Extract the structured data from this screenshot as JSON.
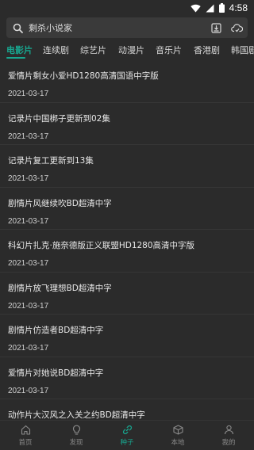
{
  "status": {
    "time": "4:58",
    "icons": [
      "wifi-icon",
      "signal-icon",
      "battery-icon"
    ]
  },
  "search": {
    "text": "剩杀小说家",
    "icons": [
      "search-icon",
      "download-icon",
      "refresh-cloud-icon"
    ]
  },
  "tabs": [
    {
      "label": "电影片",
      "active": true
    },
    {
      "label": "连续剧"
    },
    {
      "label": "综艺片"
    },
    {
      "label": "动漫片"
    },
    {
      "label": "音乐片"
    },
    {
      "label": "香港剧"
    },
    {
      "label": "韩国剧"
    }
  ],
  "items": [
    {
      "title": "爱情片剩女小爱HD1280高清国语中字版",
      "date": "2021-03-17"
    },
    {
      "title": "记录片中国梆子更新到02集",
      "date": "2021-03-17"
    },
    {
      "title": "记录片复工更新到13集",
      "date": "2021-03-17"
    },
    {
      "title": "剧情片风继续吹BD超清中字",
      "date": "2021-03-17"
    },
    {
      "title": "科幻片扎克·施奈德版正义联盟HD1280高清中字版",
      "date": "2021-03-17"
    },
    {
      "title": "剧情片放飞理想BD超清中字",
      "date": "2021-03-17"
    },
    {
      "title": "剧情片仿造者BD超清中字",
      "date": "2021-03-17"
    },
    {
      "title": "爱情片对她说BD超清中字",
      "date": "2021-03-17"
    },
    {
      "title": "动作片大汉风之入关之约BD超清中字",
      "date": ""
    }
  ],
  "bottom_nav": [
    {
      "label": "首页",
      "icon": "home-icon"
    },
    {
      "label": "发现",
      "icon": "lightbulb-icon"
    },
    {
      "label": "种子",
      "icon": "link-icon",
      "active": true
    },
    {
      "label": "本地",
      "icon": "cube-icon"
    },
    {
      "label": "我的",
      "icon": "person-icon"
    }
  ],
  "colors": {
    "accent": "#18a68f",
    "background": "#2b2b2b",
    "search_bg": "#3a3a3a"
  }
}
